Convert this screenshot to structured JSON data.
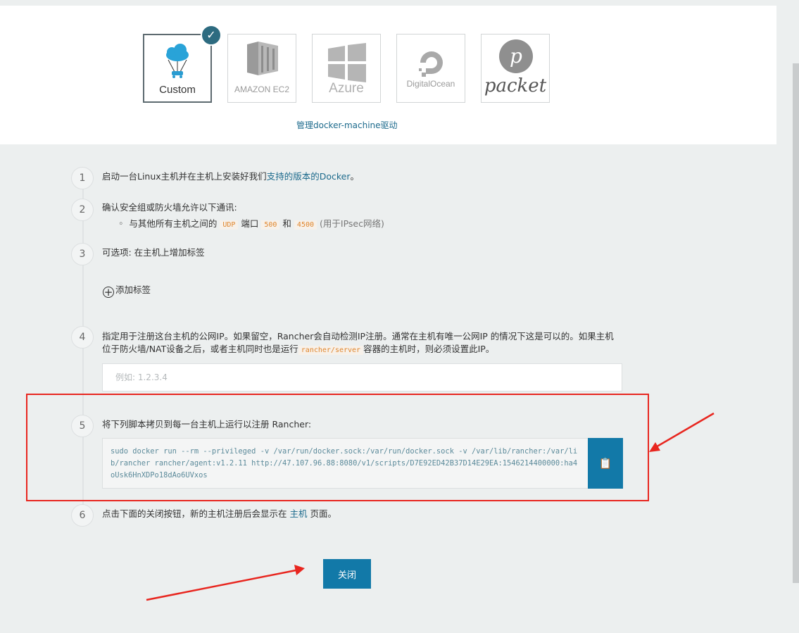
{
  "drivers": [
    {
      "label": "Custom",
      "icon": "cloud-parachute-icon",
      "selected": true
    },
    {
      "label": "AMAZON EC2",
      "icon": "server-rack-icon",
      "selected": false
    },
    {
      "label": "Azure",
      "icon": "windows-icon",
      "selected": false
    },
    {
      "label": "DigitalOcean",
      "icon": "digitalocean-icon",
      "selected": false
    },
    {
      "label": "packet",
      "icon": "packet-p-icon",
      "selected": false
    }
  ],
  "manage_link": "管理docker-machine驱动",
  "steps": [
    {
      "num": "1",
      "text_before": "启动一台Linux主机并在主机上安装好我们",
      "link": "支持的版本的Docker",
      "text_after": "。"
    },
    {
      "num": "2",
      "text": "确认安全组或防火墙允许以下通讯:",
      "bullet": {
        "prefix": "与其他所有主机之间的",
        "protocol": "UDP",
        "port_word": "端口",
        "port1": "500",
        "and_word": "和",
        "port2": "4500",
        "note": "(用于IPsec网络)"
      }
    },
    {
      "num": "3",
      "text": "可选项: 在主机上增加标签",
      "add_label": "添加标签"
    },
    {
      "num": "4",
      "text_before": "指定用于注册这台主机的公网IP。如果留空，Rancher会自动检测IP注册。通常在主机有唯一公网IP 的情况下这是可以的。如果主机位于防火墙/NAT设备之后，或者主机同时也是运行",
      "code": "rancher/server",
      "text_after": "容器的主机时，则必须设置此IP。",
      "input_placeholder": "例如: 1.2.3.4",
      "input_value": ""
    },
    {
      "num": "5",
      "text": "将下列脚本拷贝到每一台主机上运行以注册 Rancher:",
      "script": "sudo docker run --rm --privileged -v /var/run/docker.sock:/var/run/docker.sock -v /var/lib/rancher:/var/lib/rancher rancher/agent:v1.2.11 http://47.107.96.88:8080/v1/scripts/D7E92ED42B37D14E29EA:1546214400000:ha4oUsk6HnXDPo18dAo6UVxos",
      "copy_icon": "clipboard-icon"
    },
    {
      "num": "6",
      "text_before": "点击下面的关闭按钮，新的主机注册后会显示在",
      "link": "主机",
      "text_after": "页面。"
    }
  ],
  "close_button": "关闭",
  "colors": {
    "accent": "#1279a8",
    "annotation": "#e8261f",
    "checkmark": "#2d6b80"
  }
}
